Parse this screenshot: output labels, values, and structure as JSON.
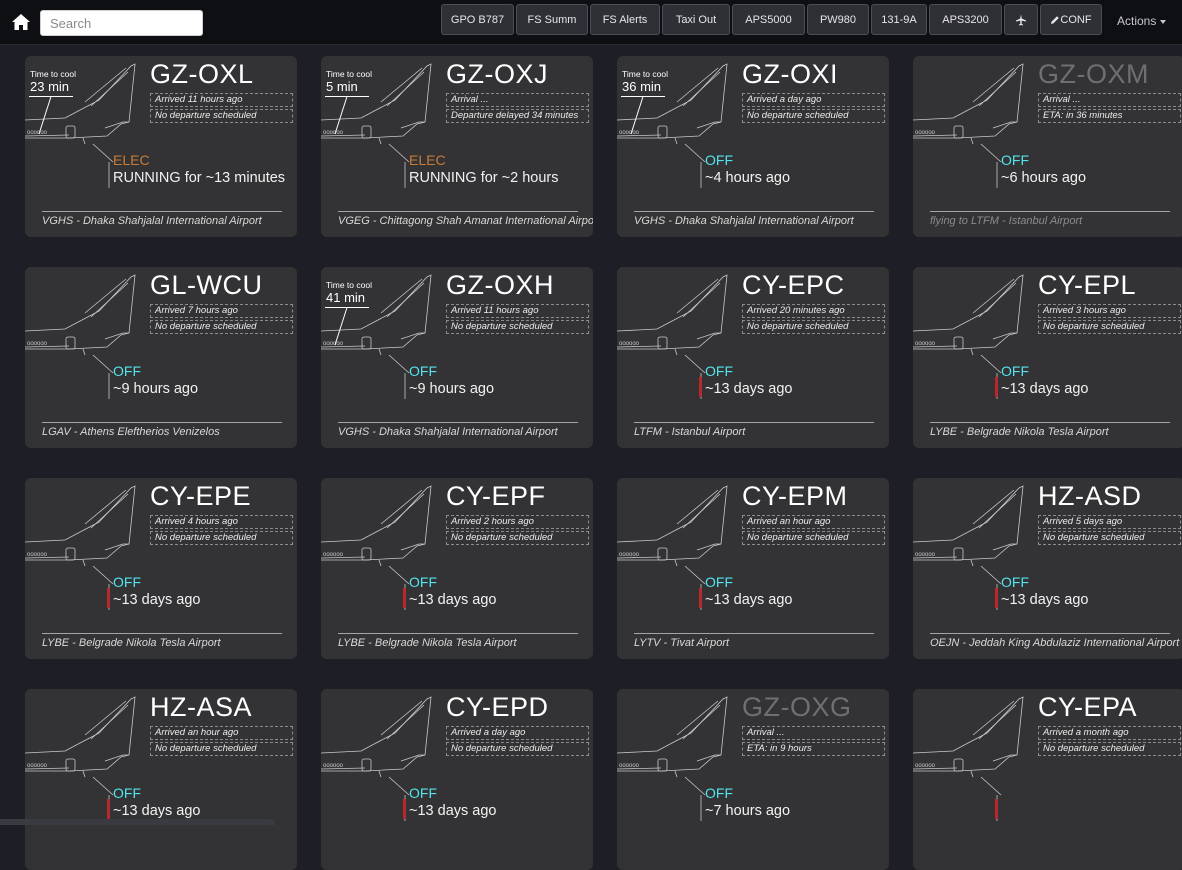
{
  "topbar": {
    "search_placeholder": "Search",
    "buttons": [
      "GPO B787",
      "FS Summ",
      "FS Alerts",
      "Taxi Out",
      "APS5000",
      "PW980",
      "131-9A",
      "APS3200",
      "",
      "CONF"
    ],
    "actions_label": "Actions",
    "colors": {
      "bar": "#0e0f13",
      "button": "#2f3036"
    }
  },
  "cards": [
    {
      "reg": "GZ-OXL",
      "reg_dim": false,
      "cool_label": "Time to cool",
      "cool_time": "23 min",
      "line1": "Arrived 11 hours ago",
      "line2": "No departure scheduled",
      "state": "ELEC",
      "state_kind": "elec",
      "since": "RUNNING for ~13 minutes",
      "location": "VGHS - Dhaka Shahjalal International Airport",
      "loc_dim": false,
      "red_tag": false
    },
    {
      "reg": "GZ-OXJ",
      "reg_dim": false,
      "cool_label": "Time to cool",
      "cool_time": "5 min",
      "line1": "Arrival ...",
      "line2": "Departure delayed 34 minutes",
      "state": "ELEC",
      "state_kind": "elec",
      "since": "RUNNING for ~2 hours",
      "location": "VGEG - Chittagong Shah Amanat International Airport",
      "loc_dim": false,
      "red_tag": false
    },
    {
      "reg": "GZ-OXI",
      "reg_dim": false,
      "cool_label": "Time to cool",
      "cool_time": "36 min",
      "line1": "Arrived a day ago",
      "line2": "No departure scheduled",
      "state": "OFF",
      "state_kind": "off",
      "since": "~4 hours ago",
      "location": "VGHS - Dhaka Shahjalal International Airport",
      "loc_dim": false,
      "red_tag": false
    },
    {
      "reg": "GZ-OXM",
      "reg_dim": true,
      "cool_label": "",
      "cool_time": "",
      "line1": "Arrival ...",
      "line2": "ETA: in 36 minutes",
      "state": "OFF",
      "state_kind": "off",
      "since": "~6 hours ago",
      "location": "flying to LTFM - Istanbul Airport",
      "loc_dim": true,
      "red_tag": false
    },
    {
      "reg": "GL-WCU",
      "reg_dim": false,
      "cool_label": "",
      "cool_time": "",
      "line1": "Arrived 7 hours ago",
      "line2": "No departure scheduled",
      "state": "OFF",
      "state_kind": "off",
      "since": "~9 hours ago",
      "location": "LGAV - Athens Eleftherios Venizelos",
      "loc_dim": false,
      "red_tag": false
    },
    {
      "reg": "GZ-OXH",
      "reg_dim": false,
      "cool_label": "Time to cool",
      "cool_time": "41 min",
      "line1": "Arrived 11 hours ago",
      "line2": "No departure scheduled",
      "state": "OFF",
      "state_kind": "off",
      "since": "~9 hours ago",
      "location": "VGHS - Dhaka Shahjalal International Airport",
      "loc_dim": false,
      "red_tag": false
    },
    {
      "reg": "CY-EPC",
      "reg_dim": false,
      "cool_label": "",
      "cool_time": "",
      "line1": "Arrived 20 minutes ago",
      "line2": "No departure scheduled",
      "state": "OFF",
      "state_kind": "off",
      "since": "~13 days ago",
      "location": "LTFM - Istanbul Airport",
      "loc_dim": false,
      "red_tag": true
    },
    {
      "reg": "CY-EPL",
      "reg_dim": false,
      "cool_label": "",
      "cool_time": "",
      "line1": "Arrived 3 hours ago",
      "line2": "No departure scheduled",
      "state": "OFF",
      "state_kind": "off",
      "since": "~13 days ago",
      "location": "LYBE - Belgrade Nikola Tesla Airport",
      "loc_dim": false,
      "red_tag": true
    },
    {
      "reg": "CY-EPE",
      "reg_dim": false,
      "cool_label": "",
      "cool_time": "",
      "line1": "Arrived 4 hours ago",
      "line2": "No departure scheduled",
      "state": "OFF",
      "state_kind": "off",
      "since": "~13 days ago",
      "location": "LYBE - Belgrade Nikola Tesla Airport",
      "loc_dim": false,
      "red_tag": true
    },
    {
      "reg": "CY-EPF",
      "reg_dim": false,
      "cool_label": "",
      "cool_time": "",
      "line1": "Arrived 2 hours ago",
      "line2": "No departure scheduled",
      "state": "OFF",
      "state_kind": "off",
      "since": "~13 days ago",
      "location": "LYBE - Belgrade Nikola Tesla Airport",
      "loc_dim": false,
      "red_tag": true
    },
    {
      "reg": "CY-EPM",
      "reg_dim": false,
      "cool_label": "",
      "cool_time": "",
      "line1": "Arrived an hour ago",
      "line2": "No departure scheduled",
      "state": "OFF",
      "state_kind": "off",
      "since": "~13 days ago",
      "location": "LYTV - Tivat Airport",
      "loc_dim": false,
      "red_tag": true
    },
    {
      "reg": "HZ-ASD",
      "reg_dim": false,
      "cool_label": "",
      "cool_time": "",
      "line1": "Arrived 5 days ago",
      "line2": "No departure scheduled",
      "state": "OFF",
      "state_kind": "off",
      "since": "~13 days ago",
      "location": "OEJN - Jeddah King Abdulaziz International Airport",
      "loc_dim": false,
      "red_tag": true
    },
    {
      "reg": "HZ-ASA",
      "reg_dim": false,
      "cool_label": "",
      "cool_time": "",
      "line1": "Arrived an hour ago",
      "line2": "No departure scheduled",
      "state": "OFF",
      "state_kind": "off",
      "since": "~13 days ago",
      "location": "",
      "loc_dim": false,
      "red_tag": true
    },
    {
      "reg": "CY-EPD",
      "reg_dim": false,
      "cool_label": "",
      "cool_time": "",
      "line1": "Arrived a day ago",
      "line2": "No departure scheduled",
      "state": "OFF",
      "state_kind": "off",
      "since": "~13 days ago",
      "location": "",
      "loc_dim": false,
      "red_tag": true
    },
    {
      "reg": "GZ-OXG",
      "reg_dim": true,
      "cool_label": "",
      "cool_time": "",
      "line1": "Arrival ...",
      "line2": "ETA: in 9 hours",
      "state": "OFF",
      "state_kind": "off",
      "since": "~7 hours ago",
      "location": "",
      "loc_dim": false,
      "red_tag": false
    },
    {
      "reg": "CY-EPA",
      "reg_dim": false,
      "cool_label": "",
      "cool_time": "",
      "line1": "Arrived a month ago",
      "line2": "No departure scheduled",
      "state": "",
      "state_kind": "off",
      "since": "",
      "location": "",
      "loc_dim": false,
      "red_tag": true
    }
  ],
  "colors": {
    "card_bg": "#333335",
    "page_bg": "#1e1f26",
    "off": "#52e4ec",
    "elec": "#c97b37",
    "dim": "#6f6f73",
    "red_tag": "#b7282c"
  }
}
